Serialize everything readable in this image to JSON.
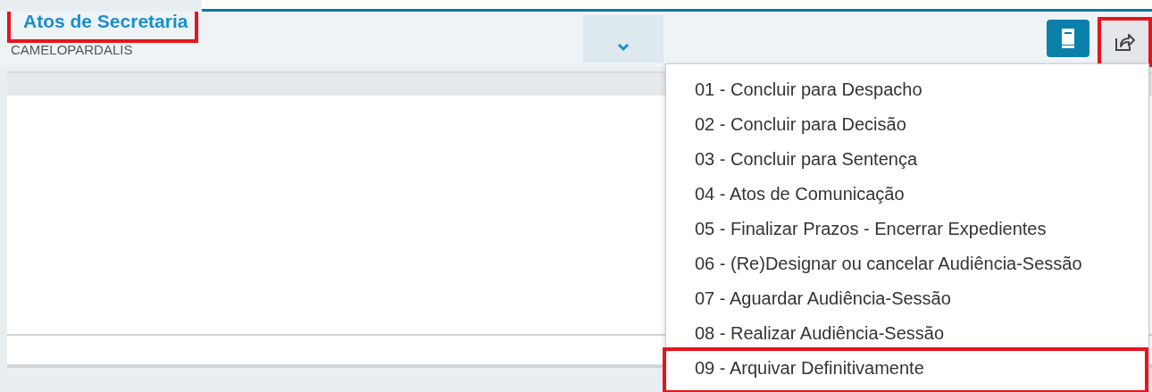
{
  "header": {
    "title": "Atos de Secretaria",
    "title_highlighted": true,
    "subtitle": "CAMELOPARDALIS"
  },
  "toolbar": {
    "dropdown_expanded": true,
    "share_highlighted": true
  },
  "menu": {
    "items": [
      {
        "label": "01 - Concluir para Despacho",
        "highlighted": false
      },
      {
        "label": "02 - Concluir para Decisão",
        "highlighted": false
      },
      {
        "label": "03 - Concluir para Sentença",
        "highlighted": false
      },
      {
        "label": "04 - Atos de Comunicação",
        "highlighted": false
      },
      {
        "label": "05 - Finalizar Prazos - Encerrar Expedientes",
        "highlighted": false
      },
      {
        "label": "06 - (Re)Designar ou cancelar Audiência-Sessão",
        "highlighted": false
      },
      {
        "label": "07 - Aguardar Audiência-Sessão",
        "highlighted": false
      },
      {
        "label": "08 - Realizar Audiência-Sessão",
        "highlighted": false
      },
      {
        "label": "09 - Arquivar Definitivamente",
        "highlighted": true
      }
    ]
  }
}
